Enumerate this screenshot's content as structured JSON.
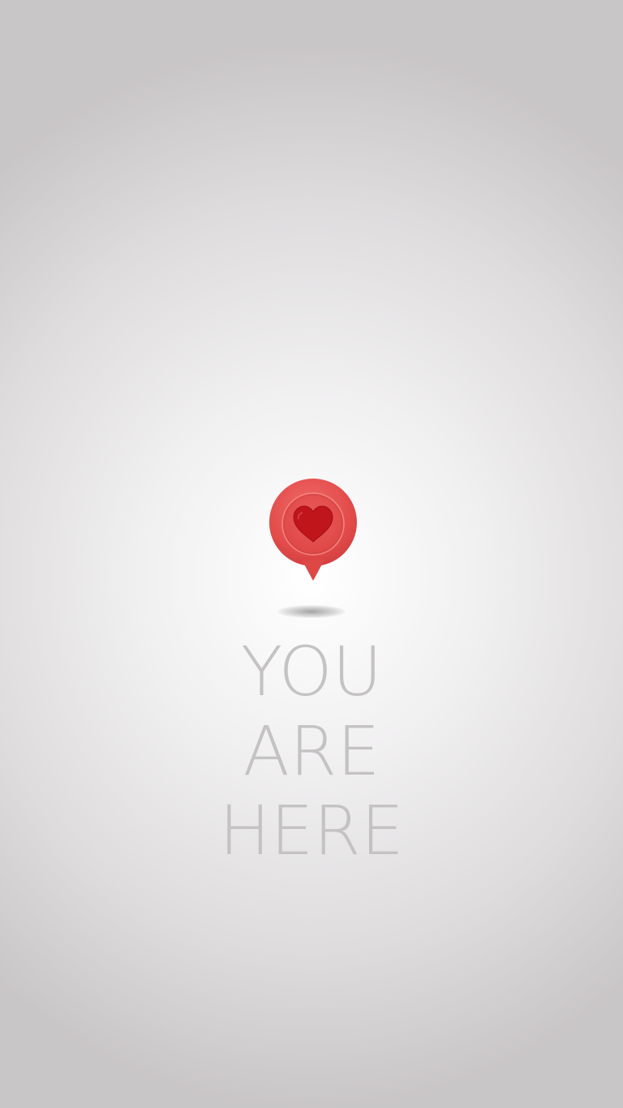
{
  "caption": {
    "line1": "YOU",
    "line2": "ARE",
    "line3": "HERE"
  },
  "icons": {
    "pin": "location-pin-icon",
    "heart": "heart-icon"
  },
  "colors": {
    "pin": "#e9504f",
    "heart": "#c0151b",
    "text": "#c4c2c3",
    "background_center": "#ffffff",
    "background_edge": "#c9c6c7"
  }
}
